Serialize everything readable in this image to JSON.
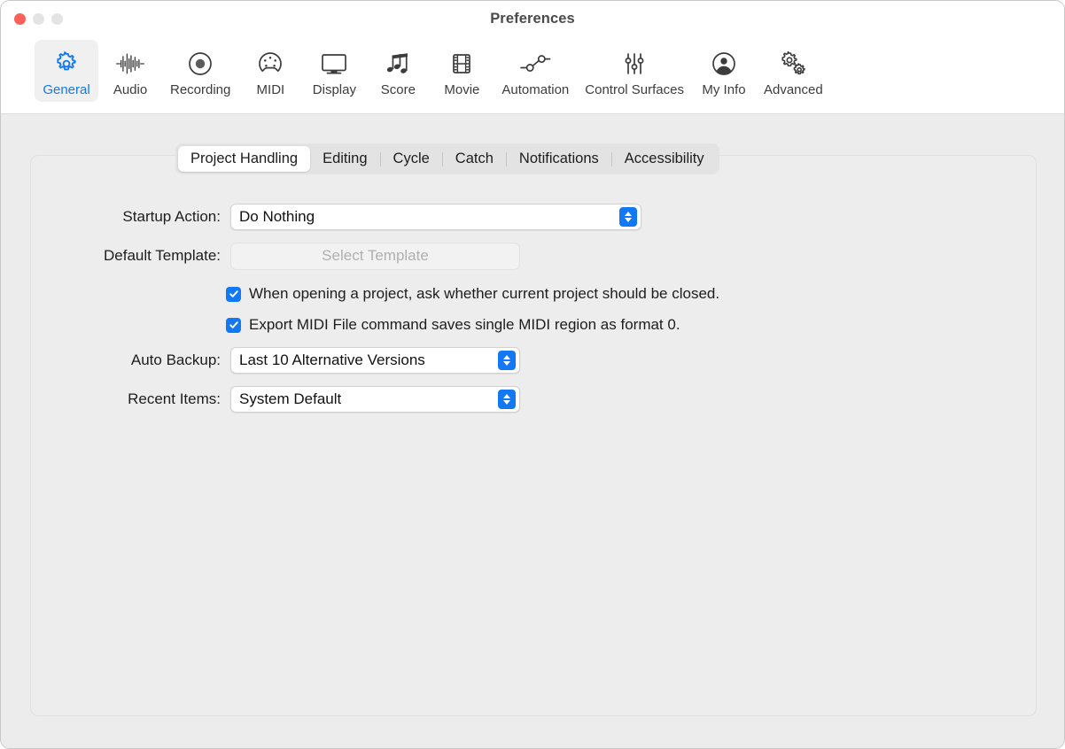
{
  "window": {
    "title": "Preferences",
    "traffic_lights": [
      "close",
      "minimize",
      "zoom"
    ]
  },
  "toolbar": {
    "items": [
      {
        "label": "General",
        "icon": "gear-icon",
        "selected": true
      },
      {
        "label": "Audio",
        "icon": "waveform-icon",
        "selected": false
      },
      {
        "label": "Recording",
        "icon": "record-circle-icon",
        "selected": false
      },
      {
        "label": "MIDI",
        "icon": "midi-din-icon",
        "selected": false
      },
      {
        "label": "Display",
        "icon": "monitor-icon",
        "selected": false
      },
      {
        "label": "Score",
        "icon": "music-notes-icon",
        "selected": false
      },
      {
        "label": "Movie",
        "icon": "film-strip-icon",
        "selected": false
      },
      {
        "label": "Automation",
        "icon": "automation-nodes-icon",
        "selected": false
      },
      {
        "label": "Control Surfaces",
        "icon": "sliders-icon",
        "selected": false
      },
      {
        "label": "My Info",
        "icon": "person-circle-icon",
        "selected": false
      },
      {
        "label": "Advanced",
        "icon": "double-gear-icon",
        "selected": false
      }
    ]
  },
  "tabs": {
    "items": [
      {
        "label": "Project Handling",
        "selected": true
      },
      {
        "label": "Editing",
        "selected": false
      },
      {
        "label": "Cycle",
        "selected": false
      },
      {
        "label": "Catch",
        "selected": false
      },
      {
        "label": "Notifications",
        "selected": false
      },
      {
        "label": "Accessibility",
        "selected": false
      }
    ]
  },
  "form": {
    "startup_action": {
      "label": "Startup Action:",
      "value": "Do Nothing"
    },
    "default_template": {
      "label": "Default Template:",
      "button_text": "Select Template",
      "enabled": false
    },
    "checkbox_ask_close": {
      "text": "When opening a project, ask whether current project should be closed.",
      "checked": true
    },
    "checkbox_export_midi": {
      "text": "Export MIDI File command saves single MIDI region as format 0.",
      "checked": true
    },
    "auto_backup": {
      "label": "Auto Backup:",
      "value": "Last 10 Alternative Versions"
    },
    "recent_items": {
      "label": "Recent Items:",
      "value": "System Default"
    }
  },
  "colors": {
    "accent": "#1378f3",
    "close_light": "#fc6058",
    "inactive_light": "#e4e4e4",
    "window_body": "#ececec",
    "panel": "#ededed",
    "toolbar": "#ffffff"
  }
}
